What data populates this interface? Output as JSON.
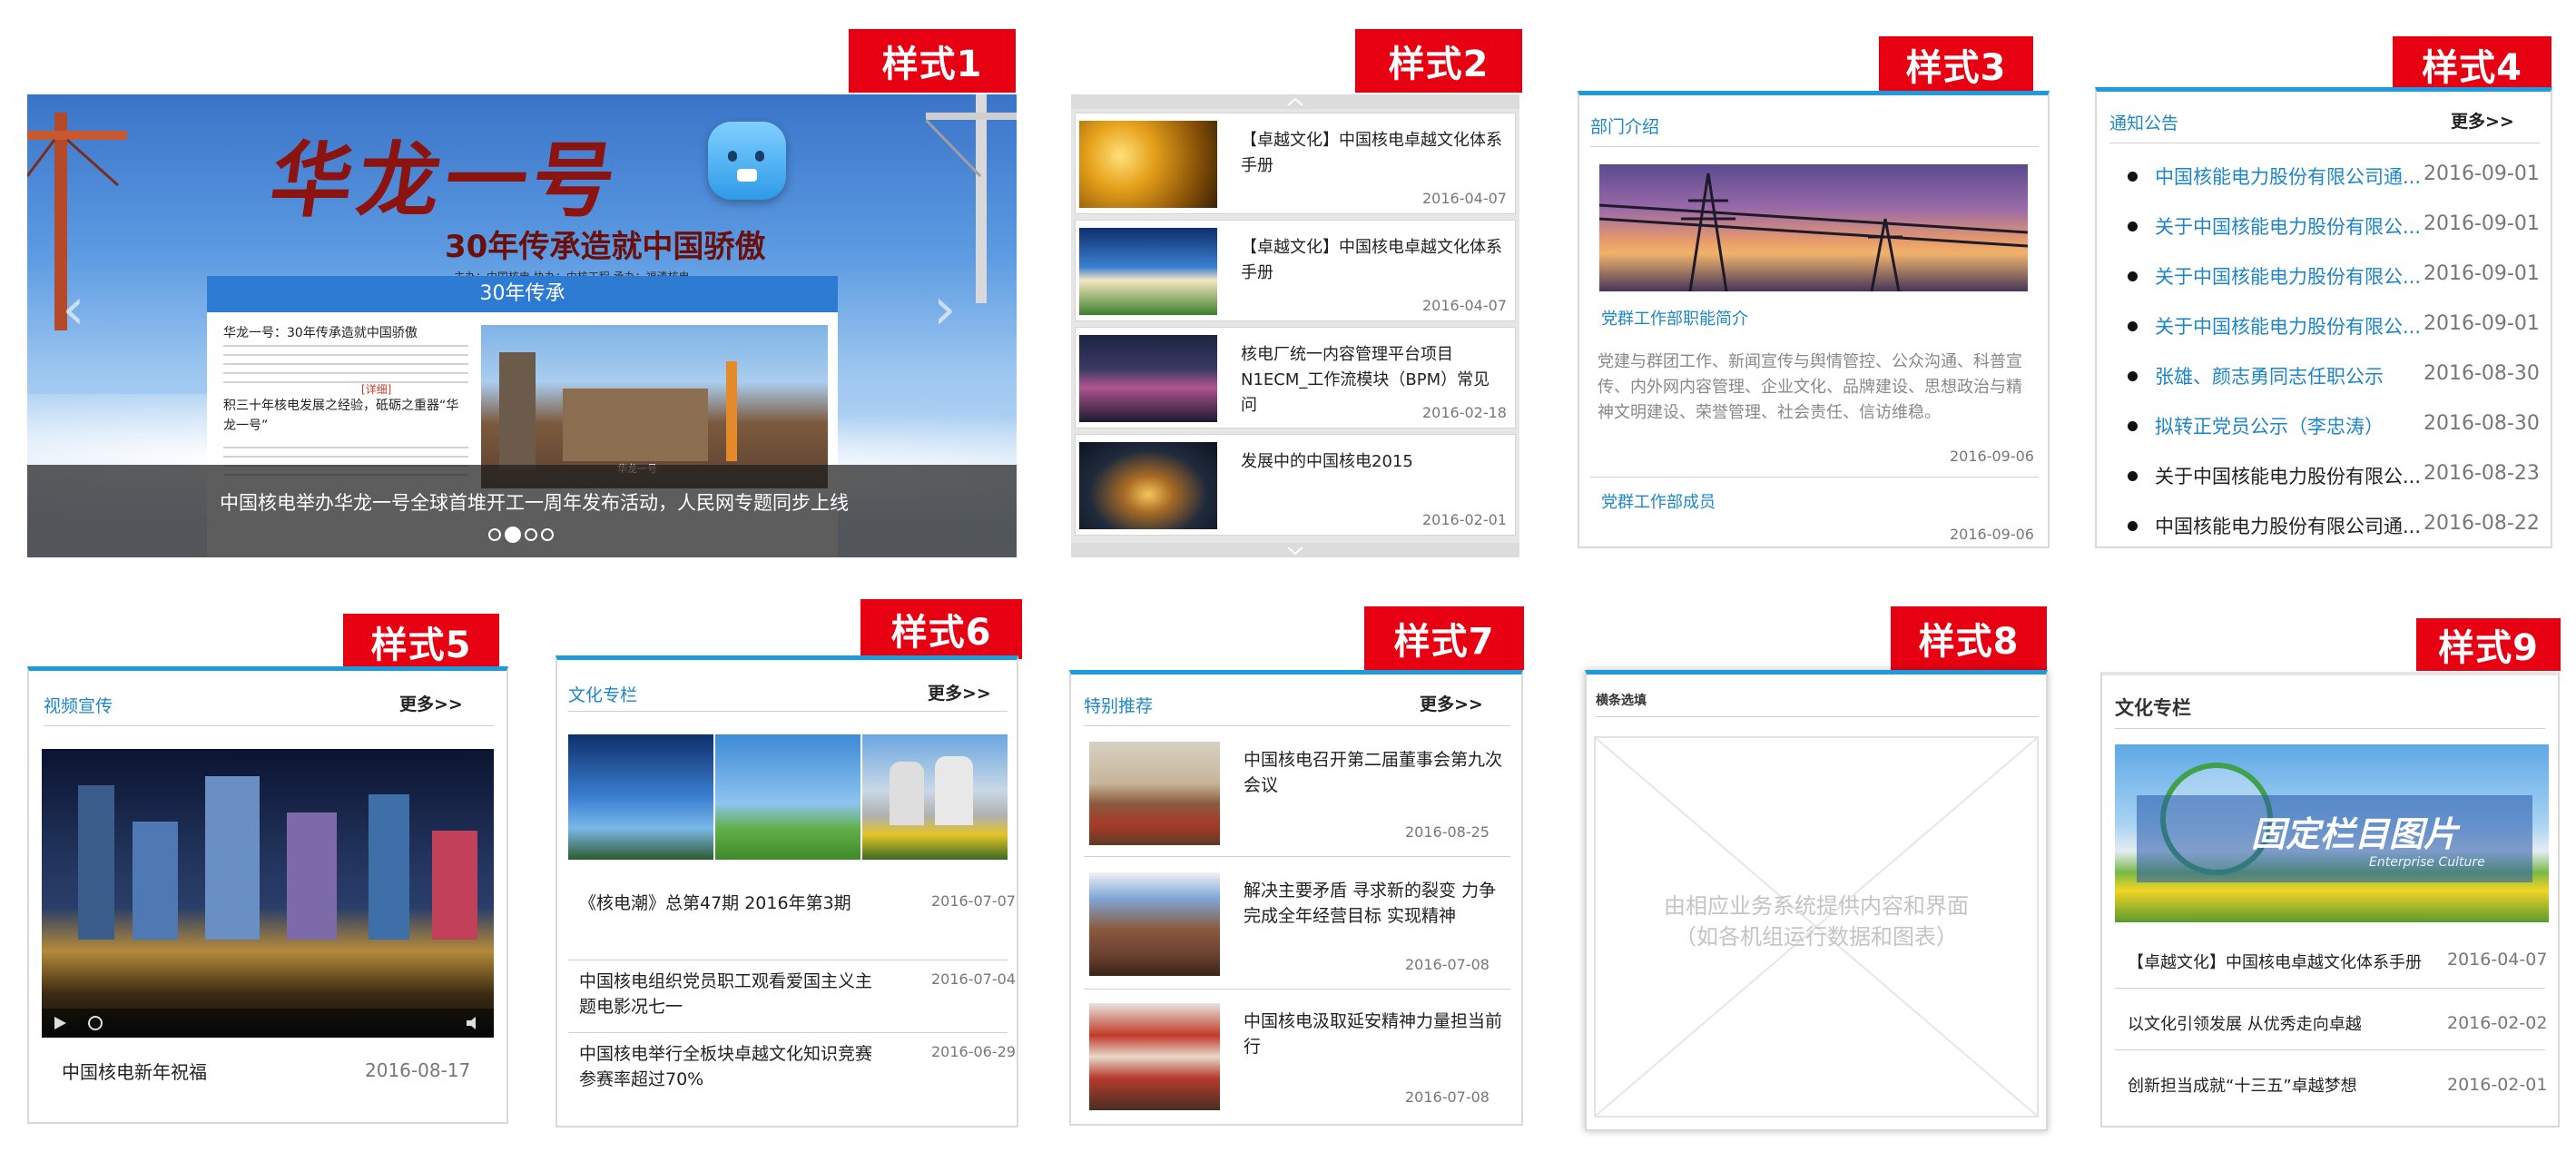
{
  "tags": [
    "样式1",
    "样式2",
    "样式3",
    "样式4",
    "样式5",
    "样式6",
    "样式7",
    "样式8",
    "样式9"
  ],
  "s1": {
    "banner_title": "华龙一号",
    "banner_subtitle": "30年传承造就中国骄傲",
    "banner_sponsors": "主办：中国核电   协办：中核工程   承办：福清核电",
    "inner_title": "30年传承",
    "inner_heading1": "华龙一号：30年传承造就中国骄傲",
    "inner_heading2": "积三十年核电发展之经验，砥砺之重器“华龙一号”",
    "inner_more": "[详细]",
    "photo_caption": "华龙一号",
    "caption": "中国核电举办华龙一号全球首堆开工一周年发布活动，人民网专题同步上线",
    "arrow_left": "‹",
    "arrow_right": "›"
  },
  "s2": {
    "items": [
      {
        "title": "【卓越文化】中国核电卓越文化体系手册",
        "date": "2016-04-07"
      },
      {
        "title": "【卓越文化】中国核电卓越文化体系手册",
        "date": "2016-04-07"
      },
      {
        "title": "核电厂统一内容管理平台项目N1ECM_工作流模块（BPM）常见问",
        "date": "2016-02-18"
      },
      {
        "title": "发展中的中国核电2015",
        "date": "2016-02-01"
      }
    ]
  },
  "s3": {
    "title": "部门介绍",
    "link1": "党群工作部职能简介",
    "desc": "党建与群团工作、新闻宣传与舆情管控、公众沟通、科普宣传、内外网内容管理、企业文化、品牌建设、思想政治与精神文明建设、荣誉管理、社会责任、信访维稳。",
    "date1": "2016-09-06",
    "link2": "党群工作部成员",
    "date2": "2016-09-06"
  },
  "s4": {
    "title": "通知公告",
    "more": "更多>>",
    "items": [
      {
        "text": "中国核能电力股份有限公司通...",
        "date": "2016-09-01",
        "blue": true
      },
      {
        "text": "关于中国核能电力股份有限公...",
        "date": "2016-09-01",
        "blue": true
      },
      {
        "text": "关于中国核能电力股份有限公...",
        "date": "2016-09-01",
        "blue": true
      },
      {
        "text": "关于中国核能电力股份有限公...",
        "date": "2016-09-01",
        "blue": true
      },
      {
        "text": "张雄、颜志勇同志任职公示",
        "date": "2016-08-30",
        "blue": true
      },
      {
        "text": "拟转正党员公示（李忠涛）",
        "date": "2016-08-30",
        "blue": true
      },
      {
        "text": "关于中国核能电力股份有限公...",
        "date": "2016-08-23",
        "blue": false
      },
      {
        "text": "中国核能电力股份有限公司通...",
        "date": "2016-08-22",
        "blue": false
      }
    ]
  },
  "s5": {
    "title": "视频宣传",
    "more": "更多>>",
    "caption": "中国核电新年祝福",
    "date": "2016-08-17"
  },
  "s6": {
    "title": "文化专栏",
    "more": "更多>>",
    "items": [
      {
        "title": "《核电潮》总第47期 2016年第3期",
        "date": "2016-07-07"
      },
      {
        "title": "中国核电组织党员职工观看爱国主义主题电影况七一",
        "date": "2016-07-04"
      },
      {
        "title": "中国核电举行全板块卓越文化知识竞赛 参赛率超过70%",
        "date": "2016-06-29"
      }
    ]
  },
  "s7": {
    "title": "特别推荐",
    "more": "更多>>",
    "items": [
      {
        "title": "中国核电召开第二届董事会第九次会议",
        "date": "2016-08-25"
      },
      {
        "title": "解决主要矛盾 寻求新的裂变 力争完成全年经营目标 实现精神",
        "date": "2016-07-08"
      },
      {
        "title": "中国核电汲取延安精神力量担当前行",
        "date": "2016-07-08"
      }
    ]
  },
  "s8": {
    "title": "横条选填",
    "placeholder": "由相应业务系统提供内容和界面\n（如各机组运行数据和图表）"
  },
  "s9": {
    "title": "文化专栏",
    "banner_text": "固定栏目图片",
    "banner_sub": "Enterprise Culture",
    "items": [
      {
        "title": "【卓越文化】中国核电卓越文化体系手册",
        "date": "2016-04-07"
      },
      {
        "title": "以文化引领发展 从优秀走向卓越",
        "date": "2016-02-02"
      },
      {
        "title": "创新担当成就“十三五”卓越梦想",
        "date": "2016-02-01"
      }
    ]
  }
}
